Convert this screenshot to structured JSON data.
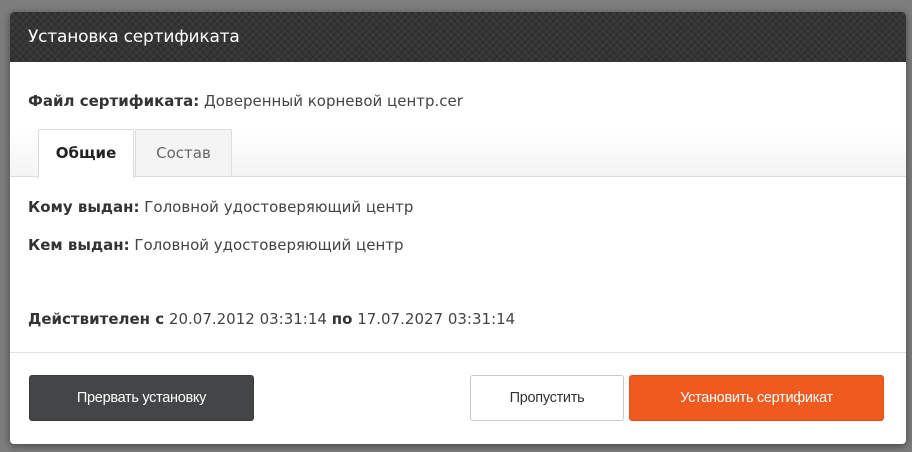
{
  "dialog": {
    "title": "Установка сертификата"
  },
  "file": {
    "label": "Файл сертификата:",
    "value": "Доверенный корневой центр.cer"
  },
  "tabs": [
    {
      "label": "Общие",
      "active": true
    },
    {
      "label": "Состав",
      "active": false
    }
  ],
  "general": {
    "issued_to_label": "Кому выдан:",
    "issued_to_value": "Головной удостоверяющий центр",
    "issued_by_label": "Кем выдан:",
    "issued_by_value": "Головной удостоверяющий центр",
    "valid_from_label": "Действителен с",
    "valid_from_value": "20.07.2012 03:31:14",
    "valid_to_label": "по",
    "valid_to_value": "17.07.2027 03:31:14"
  },
  "buttons": {
    "abort": "Прервать установку",
    "skip": "Пропустить",
    "install": "Установить сертификат"
  },
  "colors": {
    "titlebar": "#2f2f2f",
    "install_button": "#ef5a1e",
    "abort_button": "#444546"
  }
}
